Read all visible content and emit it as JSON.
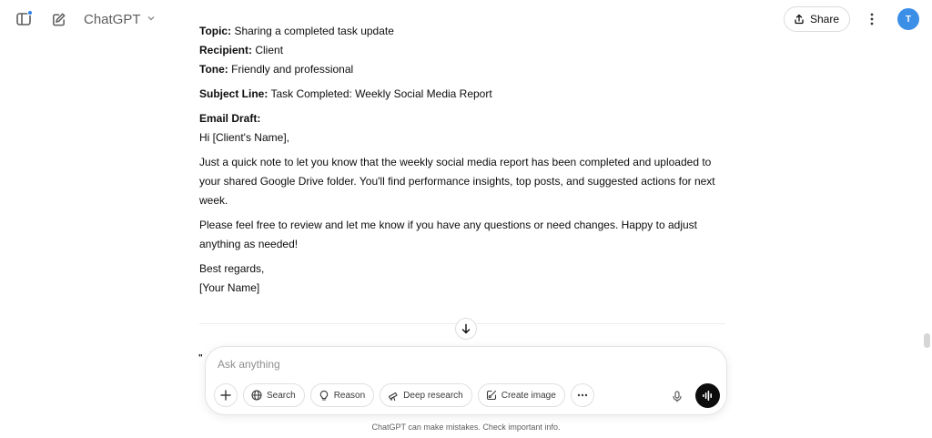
{
  "header": {
    "model_name": "ChatGPT",
    "share_label": "Share",
    "avatar_initial": "T"
  },
  "message": {
    "topic_label": "Topic:",
    "topic_value": " Sharing a completed task update",
    "recipient_label": "Recipient:",
    "recipient_value": " Client",
    "tone_label": "Tone:",
    "tone_value": " Friendly and professional",
    "subject_label": "Subject Line:",
    "subject_value": " Task Completed: Weekly Social Media Report",
    "draft_label": "Email Draft:",
    "greeting": "Hi [Client's Name],",
    "para1": "Just a quick note to let you know that the weekly social media report has been completed and uploaded to your shared Google Drive folder. You'll find performance insights, top posts, and suggested actions for next week.",
    "para2": "Please feel free to review and let me know if you have any questions or need changes. Happy to adjust anything as needed!",
    "closing": "Best regards,",
    "signature": "[Your Name]",
    "partial_next": "\""
  },
  "composer": {
    "placeholder": "Ask anything",
    "tools": {
      "search": "Search",
      "reason": "Reason",
      "deep_research": "Deep research",
      "create_image": "Create image"
    }
  },
  "footer": {
    "disclaimer": "ChatGPT can make mistakes. Check important info."
  },
  "colors": {
    "accent_dot": "#2f80ed",
    "avatar": "#3b8fe7",
    "voice_button": "#0d0d0d"
  },
  "icons": [
    "sidebar-icon",
    "new-chat-icon",
    "chevron-down-icon",
    "share-icon",
    "more-vertical-icon",
    "arrow-down-icon",
    "plus-icon",
    "globe-icon",
    "lightbulb-icon",
    "telescope-icon",
    "image-brush-icon",
    "ellipsis-icon",
    "mic-icon",
    "voice-waveform-icon"
  ]
}
